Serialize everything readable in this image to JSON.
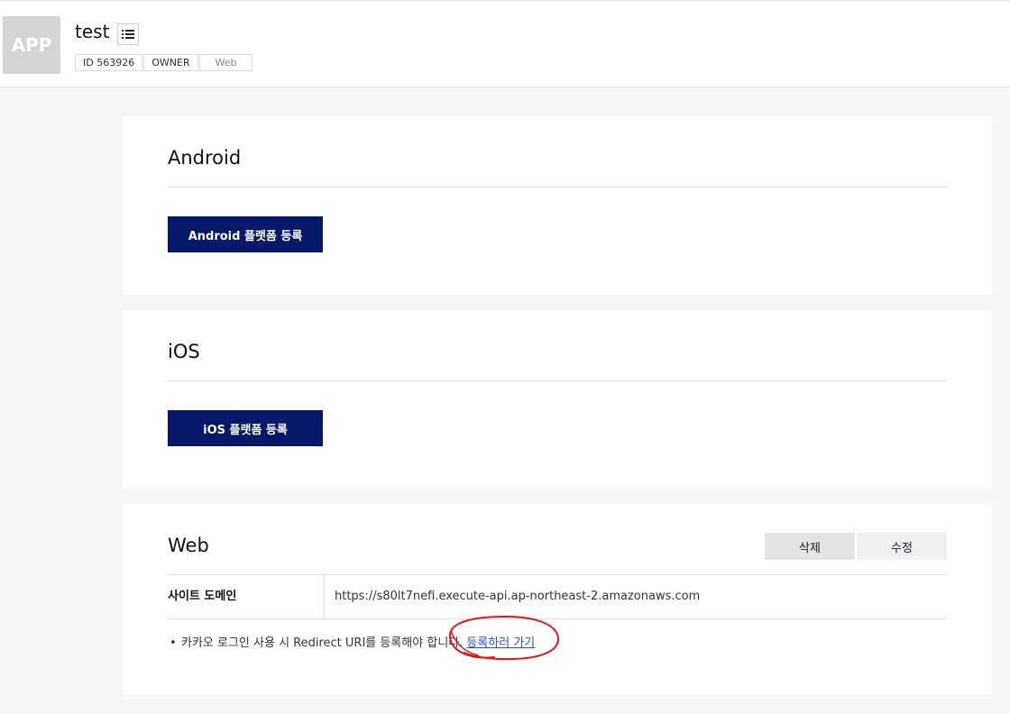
{
  "app": {
    "logo_text": "APP",
    "name": "test",
    "menu_icon": "list-icon",
    "tags": [
      "ID 563926",
      "OWNER",
      "Web"
    ]
  },
  "android": {
    "title": "Android",
    "register_label": "Android 플랫폼 등록"
  },
  "ios": {
    "title": "iOS",
    "register_label": "iOS 플랫폼 등록"
  },
  "web": {
    "title": "Web",
    "delete_label": "삭제",
    "edit_label": "수정",
    "domain_label": "사이트 도메인",
    "domain_value": "https://s80lt7nefi.execute-api.ap-northeast-2.amazonaws.com",
    "notice_text": "카카오 로그인 사용 시 Redirect URI를 등록해야 합니다.",
    "notice_link": "등록하러 가기"
  },
  "colors": {
    "primary_button": "#071868",
    "annotation": "#e0141c",
    "link": "#2b4fc4"
  }
}
